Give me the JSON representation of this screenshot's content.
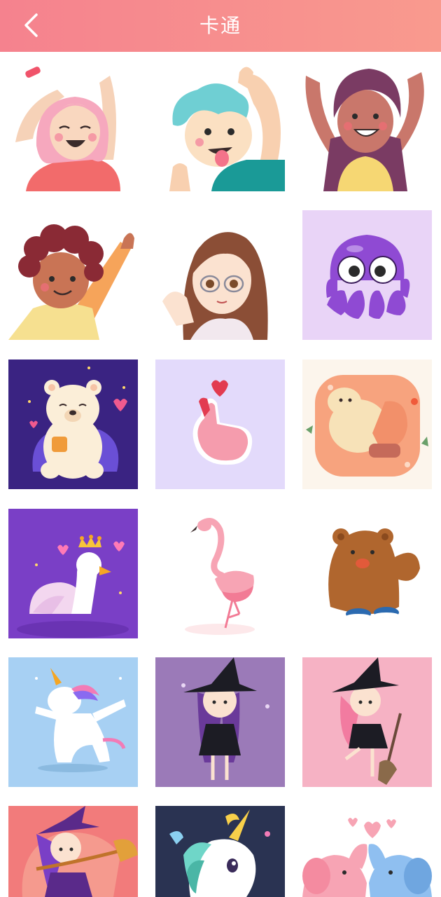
{
  "header": {
    "title": "卡通",
    "back_icon": "chevron-left-icon"
  },
  "colors": {
    "header_start": "#f5828e",
    "header_end": "#f99a8e",
    "background": "#ffffff"
  },
  "grid": {
    "items": [
      "dancing-pink-hair-girl",
      "boy-blue-hair-tongue",
      "girl-long-purple-hair",
      "curly-hair-boy-waving",
      "anime-girl-glasses",
      "purple-octopus",
      "polar-bear-with-mug",
      "finger-heart-hand",
      "cat-sleeping-on-pillow",
      "swan-with-crown",
      "pink-flamingo",
      "brown-bear",
      "dabbing-unicorn",
      "witch-girl-purple",
      "witch-girl-broom",
      "witch-girl-with-broom",
      "unicorn-head-night",
      "elephants-heart-trunks"
    ]
  }
}
